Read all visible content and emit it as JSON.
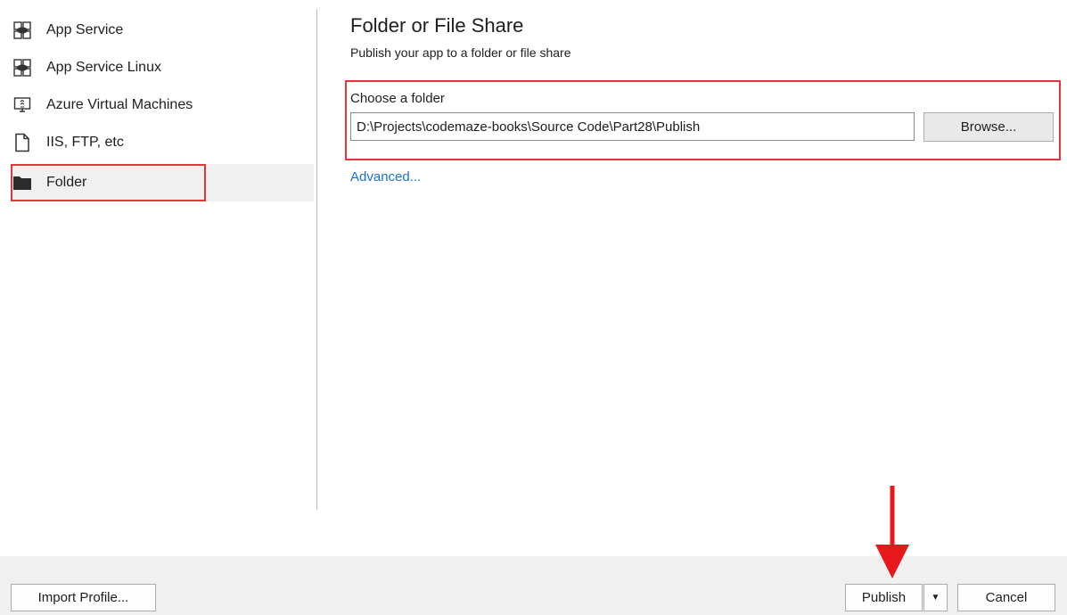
{
  "sidebar": {
    "items": [
      {
        "label": "App Service",
        "icon": "app-service-icon"
      },
      {
        "label": "App Service Linux",
        "icon": "app-service-linux-icon"
      },
      {
        "label": "Azure Virtual Machines",
        "icon": "virtual-machine-icon"
      },
      {
        "label": "IIS, FTP, etc",
        "icon": "file-icon"
      },
      {
        "label": "Folder",
        "icon": "folder-icon",
        "selected": true
      }
    ]
  },
  "main": {
    "title": "Folder or File Share",
    "subtitle": "Publish your app to a folder or file share",
    "choose_label": "Choose a folder",
    "folder_path": "D:\\Projects\\codemaze-books\\Source Code\\Part28\\Publish",
    "browse_label": "Browse...",
    "advanced_label": "Advanced..."
  },
  "footer": {
    "import_label": "Import Profile...",
    "publish_label": "Publish",
    "publish_dropdown": "▼",
    "cancel_label": "Cancel"
  },
  "colors": {
    "highlight": "#e5373a",
    "link": "#1a73c7",
    "arrow": "#e8171b"
  }
}
